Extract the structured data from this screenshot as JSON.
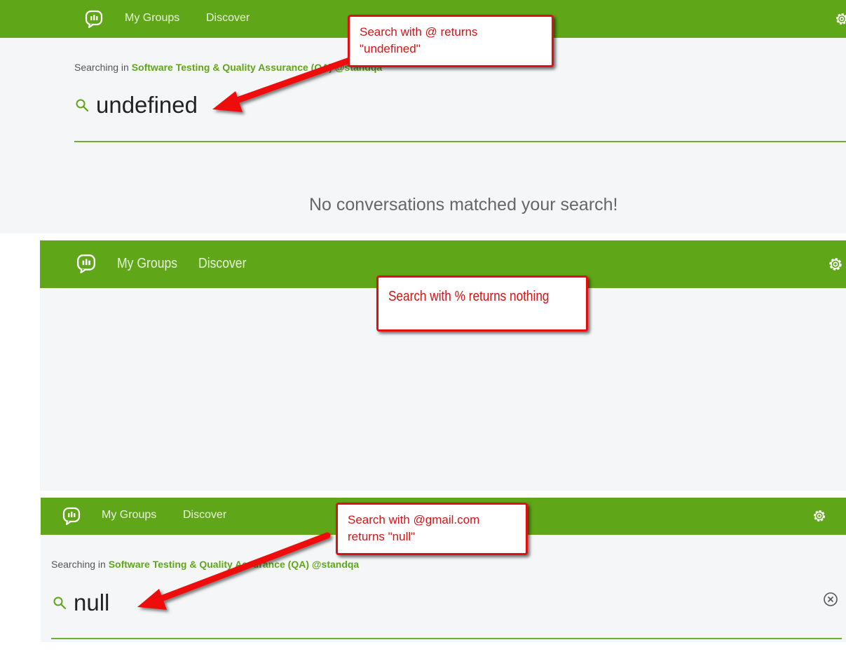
{
  "panels": [
    {
      "nav": {
        "my_groups": "My Groups",
        "discover": "Discover"
      },
      "search": {
        "context_prefix": "Searching in",
        "group_name": "Software Testing & Quality Assurance (QA) @standqa",
        "query": "undefined"
      },
      "empty_message": "No conversations matched your search!",
      "callout": {
        "line1": "Search with @ returns",
        "line2": "\"undefined\""
      }
    },
    {
      "nav": {
        "my_groups": "My Groups",
        "discover": "Discover"
      },
      "callout": {
        "line1": "Search with % returns nothing"
      }
    },
    {
      "nav": {
        "my_groups": "My Groups",
        "discover": "Discover"
      },
      "search": {
        "context_prefix": "Searching in",
        "group_name": "Software Testing & Quality Assurance (QA) @standqa",
        "query": "null"
      },
      "callout": {
        "line1": "Search with @gmail.com",
        "line2": "returns \"null\""
      }
    }
  ],
  "colors": {
    "brand_green": "#5fa618",
    "callout_red": "#e01010",
    "panel_bg": "#f5f6f7"
  },
  "icons": [
    "chat-logo-icon",
    "gear-icon",
    "search-icon",
    "clear-icon"
  ]
}
